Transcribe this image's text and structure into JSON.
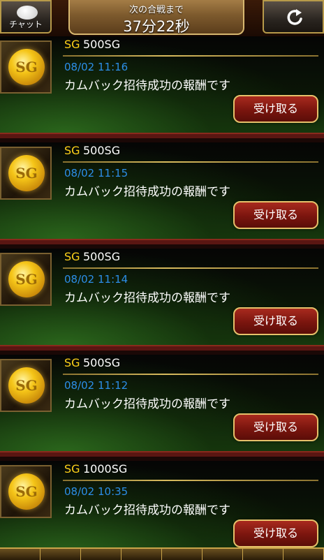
{
  "header": {
    "chat_label": "チャット",
    "timer_caption": "次の合戦まで",
    "timer_value": "37分22秒"
  },
  "messages": [
    {
      "sg_tag": "SG",
      "amount": "500SG",
      "date": "08/02 11:16",
      "text": "カムバック招待成功の報酬です",
      "button": "受け取る"
    },
    {
      "sg_tag": "SG",
      "amount": "500SG",
      "date": "08/02 11:15",
      "text": "カムバック招待成功の報酬です",
      "button": "受け取る"
    },
    {
      "sg_tag": "SG",
      "amount": "500SG",
      "date": "08/02 11:14",
      "text": "カムバック招待成功の報酬です",
      "button": "受け取る"
    },
    {
      "sg_tag": "SG",
      "amount": "500SG",
      "date": "08/02 11:12",
      "text": "カムバック招待成功の報酬です",
      "button": "受け取る"
    },
    {
      "sg_tag": "SG",
      "amount": "1000SG",
      "date": "08/02 10:35",
      "text": "カムバック招待成功の報酬です",
      "button": "受け取る"
    }
  ],
  "coin_label": "SG",
  "icons": {
    "chat": "speech-bubble-icon",
    "refresh": "refresh-icon",
    "coin": "sg-coin-icon"
  },
  "colors": {
    "sg_tag": "#ffd21a",
    "date": "#2c8ee8",
    "button": "#7a150e",
    "border_gold": "#d8bb5e"
  }
}
